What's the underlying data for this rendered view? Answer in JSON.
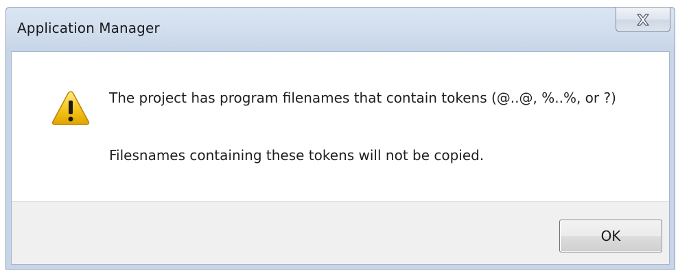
{
  "window": {
    "title": "Application Manager"
  },
  "dialog": {
    "message_line1": "The project has program filenames that contain tokens (@..@, %..%, or ?)",
    "message_line2": "Filesnames containing these tokens will not be copied.",
    "icon": "warning-icon"
  },
  "buttons": {
    "ok_label": "OK",
    "close_icon": "close-icon"
  },
  "colors": {
    "title_bar": "#cfdcec",
    "button_area": "#f0f0f0",
    "warning_fill": "#f5c518"
  }
}
